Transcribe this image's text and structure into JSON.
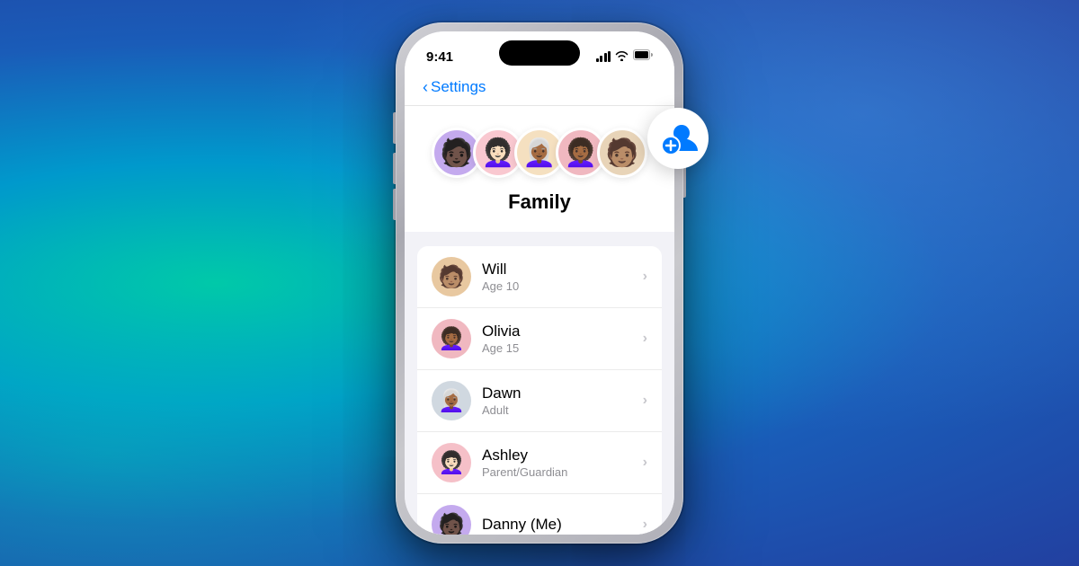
{
  "background": {
    "description": "Gradient background teal to blue"
  },
  "phone": {
    "status_bar": {
      "time": "9:41"
    },
    "nav": {
      "back_label": "Settings"
    },
    "header": {
      "title": "Family"
    },
    "avatars": [
      {
        "id": "avatar-1",
        "emoji": "🧑🏿",
        "bg": "av-purple"
      },
      {
        "id": "avatar-2",
        "emoji": "👩🏻‍🦱",
        "bg": "av-pink"
      },
      {
        "id": "avatar-3",
        "emoji": "👩🏾‍🦳",
        "bg": "av-tan"
      },
      {
        "id": "avatar-4",
        "emoji": "👩🏾‍🦱",
        "bg": "av-rose"
      },
      {
        "id": "avatar-5",
        "emoji": "🧑🏽",
        "bg": "av-beige"
      }
    ],
    "members": [
      {
        "id": "will",
        "name": "Will",
        "age_label": "Age 10",
        "emoji": "🧑🏽",
        "bg": "av-sm-brown"
      },
      {
        "id": "olivia",
        "name": "Olivia",
        "age_label": "Age 15",
        "emoji": "👩🏾‍🦱",
        "bg": "av-sm-rose"
      },
      {
        "id": "dawn",
        "name": "Dawn",
        "age_label": "Adult",
        "emoji": "👩🏾‍🦳",
        "bg": "av-sm-gray"
      },
      {
        "id": "ashley",
        "name": "Ashley",
        "age_label": "Parent/Guardian",
        "emoji": "👩🏻‍🦱",
        "bg": "av-sm-pink"
      },
      {
        "id": "danny",
        "name": "Danny (Me)",
        "age_label": "",
        "emoji": "🧑🏿",
        "bg": "av-purple"
      }
    ],
    "add_button": {
      "label": "Add Family Member"
    }
  }
}
